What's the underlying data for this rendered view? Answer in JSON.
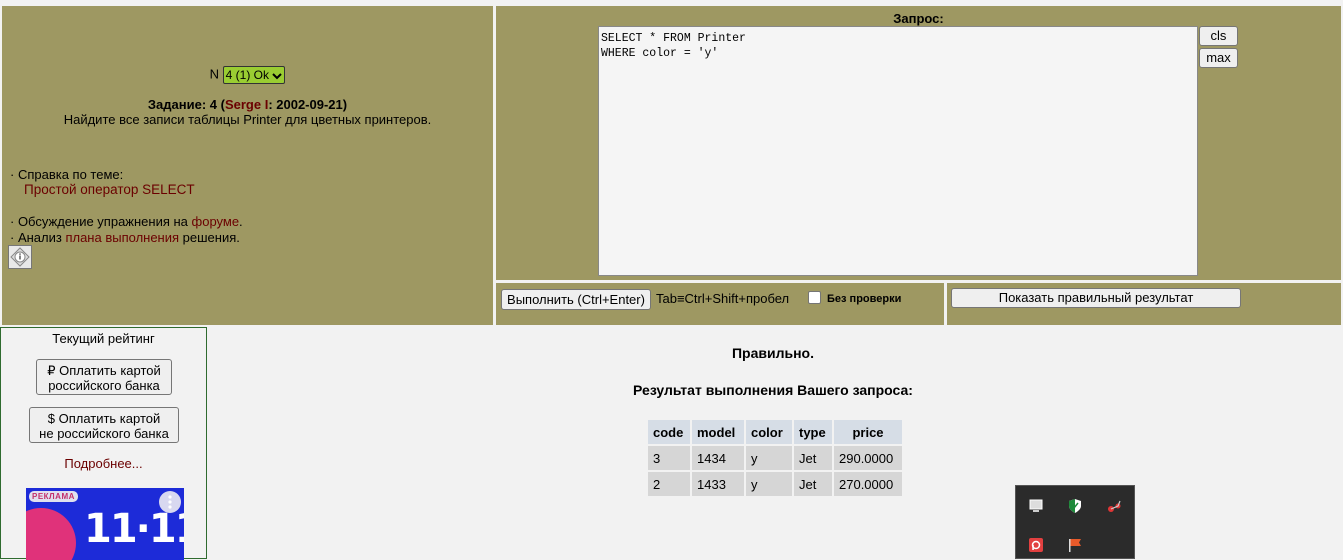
{
  "task_panel": {
    "n_label": "N",
    "n_selected": "4 (1) Ok",
    "task_prefix": "Задание: 4 (",
    "task_author": "Serge I",
    "task_suffix": ": 2002-09-21)",
    "task_description": "Найдите все записи таблицы Printer для цветных принтеров.",
    "reference_title": "· Справка по теме:",
    "reference_link": "Простой оператор SELECT",
    "discussion_prefix": "· Обсуждение упражнения на ",
    "discussion_link": "форуме",
    "discussion_suffix": ".",
    "analysis_prefix": "· Анализ ",
    "analysis_link": "плана выполнения",
    "analysis_suffix": " решения."
  },
  "query_panel": {
    "label": "Запрос:",
    "query_text": "SELECT * FROM Printer\nWHERE color = 'y'",
    "cls_label": "cls",
    "max_label": "max",
    "run_label": "Выполнить (Ctrl+Enter)",
    "tab_hint": "Tab≡Ctrl+Shift+пробел",
    "no_check_label": "Без проверки",
    "show_correct_label": "Показать правильный результат"
  },
  "sidebar": {
    "rating_title": "Текущий рейтинг",
    "pay_russian_line1": "₽ Оплатить картой",
    "pay_russian_line2": "российского банка",
    "pay_foreign_line1": "$ Оплатить картой",
    "pay_foreign_line2": "не российского банка",
    "more_link": "Подробнее...",
    "ad_badge": "РЕКЛАМА",
    "ad_promo": "11·11"
  },
  "result": {
    "status": "Правильно.",
    "title": "Результат выполнения Вашего запроса:",
    "columns": [
      "code",
      "model",
      "color",
      "type",
      "price"
    ],
    "rows": [
      [
        "3",
        "1434",
        "y",
        "Jet",
        "290.0000"
      ],
      [
        "2",
        "1433",
        "y",
        "Jet",
        "270.0000"
      ]
    ]
  },
  "colors": {
    "panel_bg": "#9e9862",
    "link": "#6b0000",
    "select_bg": "#9acd32"
  },
  "tray_icons": [
    "monitor-icon",
    "shield-icon",
    "network-icon",
    "red-app-icon",
    "flag-icon"
  ]
}
